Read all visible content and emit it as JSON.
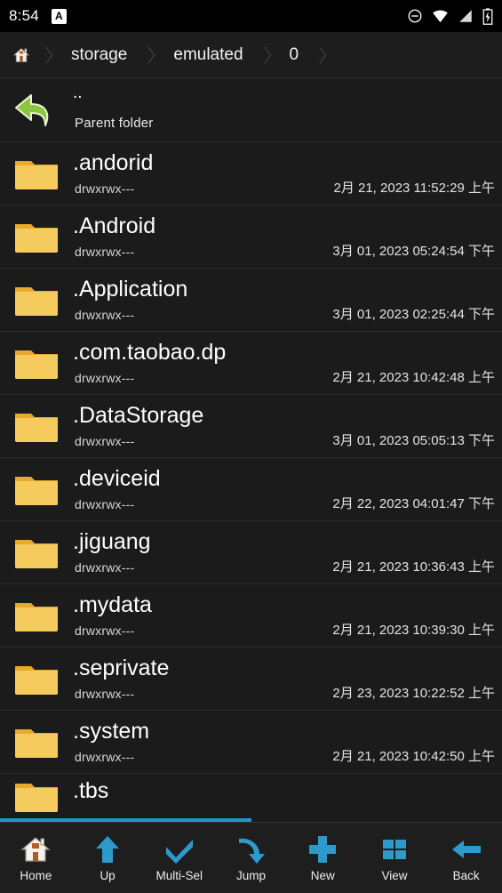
{
  "statusbar": {
    "time": "8:54",
    "ime_badge": "A",
    "icons": [
      "do-not-disturb-icon",
      "wifi-icon",
      "signal-icon",
      "battery-charging-icon"
    ]
  },
  "breadcrumb": {
    "home_icon": "home-icon",
    "items": [
      {
        "label": "storage"
      },
      {
        "label": "emulated"
      },
      {
        "label": "0"
      }
    ]
  },
  "parent_row": {
    "icon": "back-arrow-icon",
    "name": "..",
    "subtitle": "Parent folder"
  },
  "files": [
    {
      "icon": "folder-icon",
      "name": ".andorid",
      "perm": "drwxrwx---",
      "date": "2月 21, 2023 11:52:29 上午"
    },
    {
      "icon": "folder-icon",
      "name": ".Android",
      "perm": "drwxrwx---",
      "date": "3月 01, 2023 05:24:54 下午"
    },
    {
      "icon": "folder-icon",
      "name": ".Application",
      "perm": "drwxrwx---",
      "date": "3月 01, 2023 02:25:44 下午"
    },
    {
      "icon": "folder-icon",
      "name": ".com.taobao.dp",
      "perm": "drwxrwx---",
      "date": "2月 21, 2023 10:42:48 上午"
    },
    {
      "icon": "folder-icon",
      "name": ".DataStorage",
      "perm": "drwxrwx---",
      "date": "3月 01, 2023 05:05:13 下午"
    },
    {
      "icon": "folder-icon",
      "name": ".deviceid",
      "perm": "drwxrwx---",
      "date": "2月 22, 2023 04:01:47 下午"
    },
    {
      "icon": "folder-icon",
      "name": ".jiguang",
      "perm": "drwxrwx---",
      "date": "2月 21, 2023 10:36:43 上午"
    },
    {
      "icon": "folder-icon",
      "name": ".mydata",
      "perm": "drwxrwx---",
      "date": "2月 21, 2023 10:39:30 上午"
    },
    {
      "icon": "folder-icon",
      "name": ".seprivate",
      "perm": "drwxrwx---",
      "date": "2月 23, 2023 10:22:52 上午"
    },
    {
      "icon": "folder-icon",
      "name": ".system",
      "perm": "drwxrwx---",
      "date": "2月 21, 2023 10:42:50 上午"
    },
    {
      "icon": "folder-icon",
      "name": ".tbs",
      "perm": "",
      "date": ""
    }
  ],
  "scrollbar": {
    "thumb_percent": "50%"
  },
  "toolbar": {
    "buttons": [
      {
        "icon": "house-icon",
        "label": "Home"
      },
      {
        "icon": "arrow-up-icon",
        "label": "Up"
      },
      {
        "icon": "checkmark-icon",
        "label": "Multi-Sel"
      },
      {
        "icon": "curved-arrow-icon",
        "label": "Jump"
      },
      {
        "icon": "plus-icon",
        "label": "New"
      },
      {
        "icon": "grid-icon",
        "label": "View"
      },
      {
        "icon": "arrow-left-icon",
        "label": "Back"
      }
    ]
  },
  "colors": {
    "accent": "#2196c4",
    "folder": "#f2c14a",
    "parent_arrow": "#8cc63f",
    "background": "#1b1b1b",
    "toolbar_icon": "#2e9acb"
  }
}
